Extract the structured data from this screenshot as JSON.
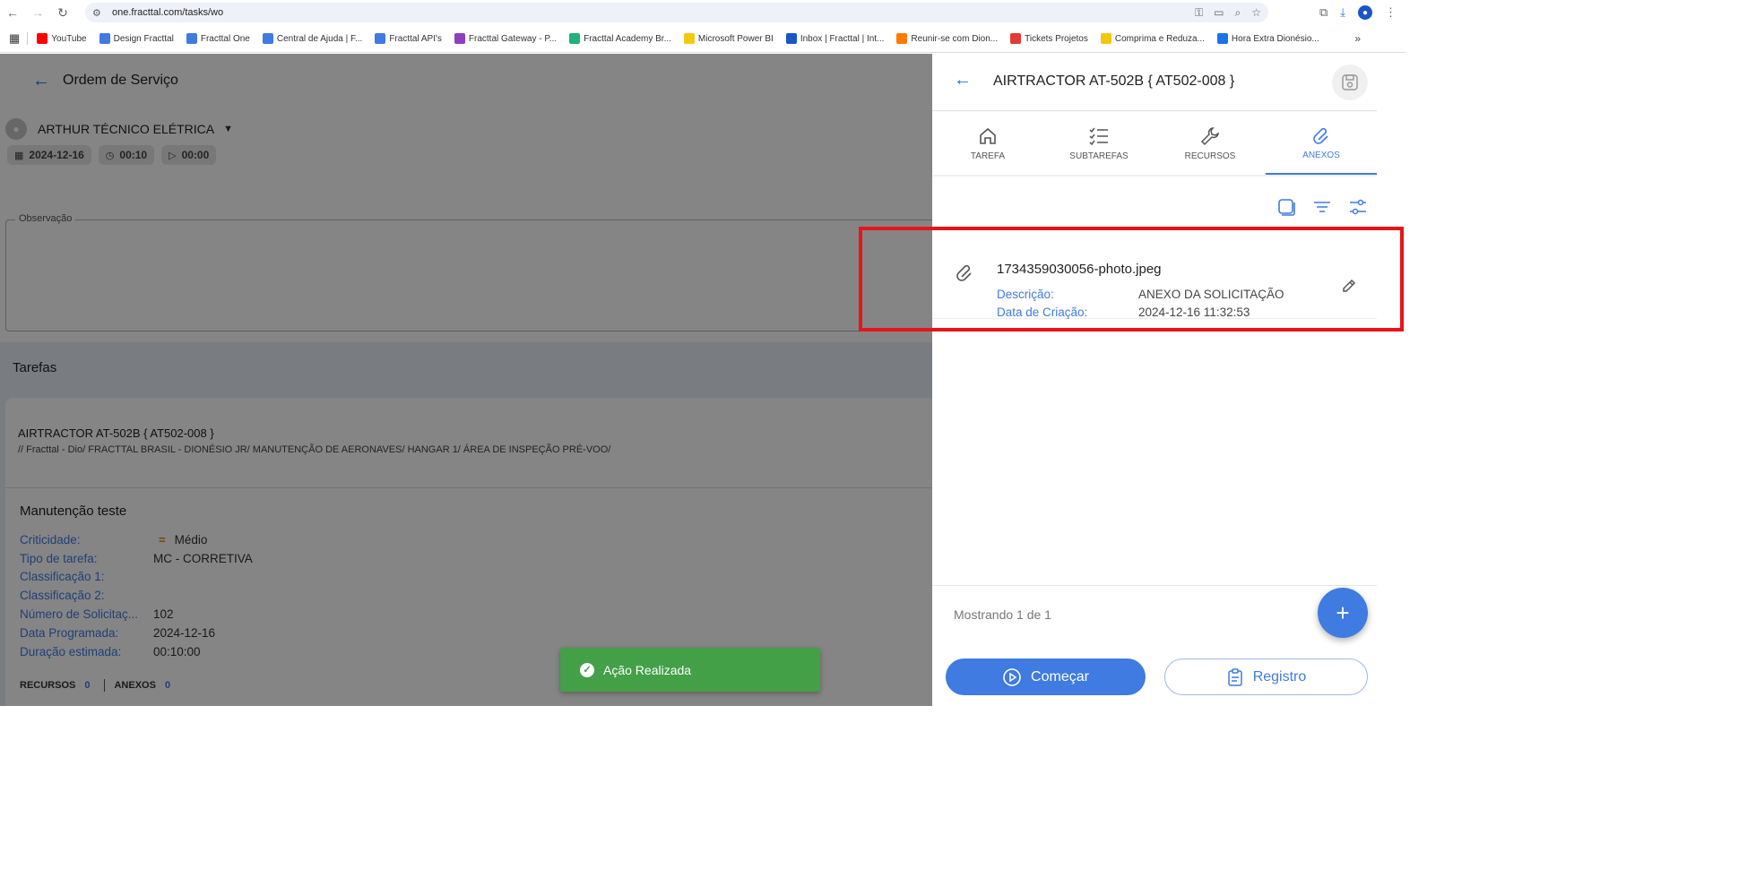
{
  "browser": {
    "url": "one.fracttal.com/tasks/wo",
    "bookmarks": [
      {
        "label": "YouTube",
        "color": "#ff0000"
      },
      {
        "label": "Design Fracttal",
        "color": "#3f7be0"
      },
      {
        "label": "Fracttal One",
        "color": "#3f7be0"
      },
      {
        "label": "Central de Ajuda | F...",
        "color": "#3f7be0"
      },
      {
        "label": "Fracttal API's",
        "color": "#3f7be0"
      },
      {
        "label": "Fracttal Gateway - P...",
        "color": "#8e3fbf"
      },
      {
        "label": "Fracttal Academy Br...",
        "color": "#1db37a"
      },
      {
        "label": "Microsoft Power BI",
        "color": "#f2c811"
      },
      {
        "label": "Inbox | Fracttal | Int...",
        "color": "#1a56c9"
      },
      {
        "label": "Reunir-se com Dion...",
        "color": "#ff7a00"
      },
      {
        "label": "Tickets Projetos",
        "color": "#e53935"
      },
      {
        "label": "Comprima e Reduza...",
        "color": "#f2c811"
      },
      {
        "label": "Hora Extra Dionésio...",
        "color": "#1a73e8"
      }
    ]
  },
  "page": {
    "title": "Ordem de Serviço",
    "technician": "ARTHUR TÉCNICO ELÉTRICA",
    "date": "2024-12-16",
    "duration": "00:10",
    "elapsed": "00:00",
    "observation_label": "Observação",
    "tasks_title": "Tarefas",
    "asset_name": "AIRTRACTOR AT-502B { AT502-008 }",
    "asset_path": "// Fracttal - Dio/ FRACTTAL BRASIL - DIONÉSIO JR/ MANUTENÇÃO DE AERONAVES/ HANGAR 1/ ÁREA DE INSPEÇÃO PRÉ-VOO/",
    "maintenance_title": "Manutenção teste",
    "fields": [
      {
        "label": "Criticidade:",
        "value": "Médio"
      },
      {
        "label": "Tipo de tarefa:",
        "value": "MC - CORRETIVA"
      },
      {
        "label": "Classificação 1:",
        "value": ""
      },
      {
        "label": "Classificação 2:",
        "value": ""
      },
      {
        "label": "Número de Solicitaç...",
        "value": "102"
      },
      {
        "label": "Data Programada:",
        "value": "2024-12-16"
      },
      {
        "label": "Duração estimada:",
        "value": "00:10:00"
      }
    ],
    "resources_label": "RECURSOS",
    "resources_count": "0",
    "attachments_label": "ANEXOS",
    "attachments_count": "0"
  },
  "toast": {
    "message": "Ação Realizada"
  },
  "panel": {
    "title": "AIRTRACTOR AT-502B { AT502-008 }",
    "tabs": [
      {
        "label": "TAREFA",
        "icon": "home-icon"
      },
      {
        "label": "SUBTAREFAS",
        "icon": "checklist-icon"
      },
      {
        "label": "RECURSOS",
        "icon": "wrench-icon"
      },
      {
        "label": "ANEXOS",
        "icon": "paperclip-icon"
      }
    ],
    "attachment": {
      "filename": "1734359030056-photo.jpeg",
      "description_label": "Descrição:",
      "description_value": "ANEXO DA SOLICITAÇÃO",
      "created_label": "Data de Criação:",
      "created_value": "2024-12-16 11:32:53"
    },
    "showing": "Mostrando 1 de 1",
    "start_label": "Começar",
    "register_label": "Registro"
  },
  "colors": {
    "accent": "#3f7be0",
    "toast": "#43a047",
    "highlight": "#e8141b"
  }
}
